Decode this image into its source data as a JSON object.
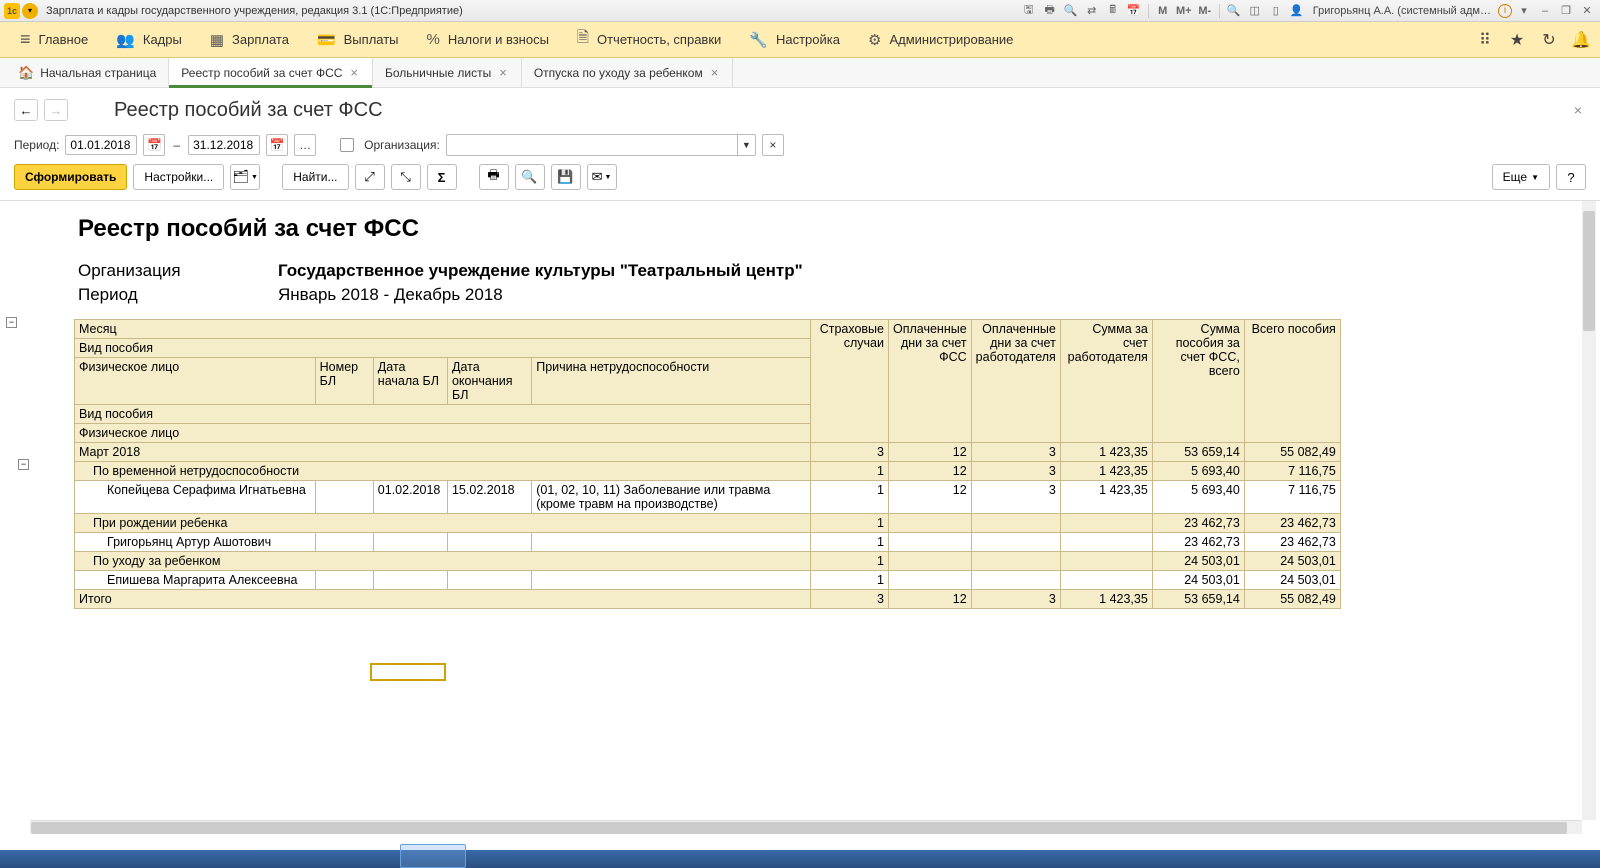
{
  "titlebar": {
    "app_title": "Зарплата и кадры государственного учреждения, редакция 3.1  (1С:Предприятие)",
    "user": "Григорьянц А.А. (системный адм…"
  },
  "mainmenu": {
    "items": [
      {
        "icon": "≡",
        "label": "Главное"
      },
      {
        "icon": "👥",
        "label": "Кадры"
      },
      {
        "icon": "▦",
        "label": "Зарплата"
      },
      {
        "icon": "💳",
        "label": "Выплаты"
      },
      {
        "icon": "%",
        "label": "Налоги и взносы"
      },
      {
        "icon": "🗎",
        "label": "Отчетность, справки"
      },
      {
        "icon": "🔧",
        "label": "Настройка"
      },
      {
        "icon": "⚙",
        "label": "Администрирование"
      }
    ]
  },
  "tabs": {
    "home": "Начальная страница",
    "items": [
      {
        "label": "Реестр пособий за счет ФСС",
        "active": true
      },
      {
        "label": "Больничные листы",
        "active": false
      },
      {
        "label": "Отпуска по уходу за ребенком",
        "active": false
      }
    ]
  },
  "page": {
    "title": "Реестр пособий за счет ФСС"
  },
  "filter": {
    "period_label": "Период:",
    "date_from": "01.01.2018",
    "date_to": "31.12.2018",
    "org_label": "Организация:"
  },
  "toolbar": {
    "generate": "Сформировать",
    "settings": "Настройки...",
    "find": "Найти...",
    "more": "Еще"
  },
  "report": {
    "title": "Реестр пособий за счет ФСС",
    "org_label": "Организация",
    "org_value": "Государственное учреждение культуры \"Театральный центр\"",
    "period_label": "Период",
    "period_value": "Январь 2018 - Декабрь 2018",
    "headers": {
      "month": "Месяц",
      "benefit_type": "Вид пособия",
      "person": "Физическое лицо",
      "bl_num": "Номер БЛ",
      "bl_start": "Дата начала БЛ",
      "bl_end": "Дата окончания БЛ",
      "reason": "Причина нетрудоспособности",
      "benefit_type2": "Вид пособия",
      "person2": "Физическое лицо",
      "ins_cases": "Страховые случаи",
      "paid_fss": "Оплаченные дни за счет ФСС",
      "paid_emp": "Оплаченные дни за счет работодателя",
      "sum_emp": "Сумма за счет работодателя",
      "sum_fss": "Сумма пособия за счет ФСС, всего",
      "sum_total": "Всего пособия"
    },
    "rows": [
      {
        "lvl": 0,
        "shade": true,
        "c0": "Март 2018",
        "ins": "3",
        "dfss": "12",
        "demp": "3",
        "semp": "1 423,35",
        "sfss": "53 659,14",
        "stot": "55 082,49"
      },
      {
        "lvl": 1,
        "shade": true,
        "c0": "По временной нетрудоспособности",
        "ins": "1",
        "dfss": "12",
        "demp": "3",
        "semp": "1 423,35",
        "sfss": "5 693,40",
        "stot": "7 116,75"
      },
      {
        "lvl": 2,
        "shade": false,
        "c0": "Копейцева Серафима Игнатьевна",
        "bl_num": "",
        "bl_start": "01.02.2018",
        "bl_end": "15.02.2018",
        "reason": "(01, 02, 10, 11) Заболевание или травма (кроме травм на производстве)",
        "ins": "1",
        "dfss": "12",
        "demp": "3",
        "semp": "1 423,35",
        "sfss": "5 693,40",
        "stot": "7 116,75"
      },
      {
        "lvl": 1,
        "shade": true,
        "c0": "При рождении ребенка",
        "ins": "1",
        "dfss": "",
        "demp": "",
        "semp": "",
        "sfss": "23 462,73",
        "stot": "23 462,73"
      },
      {
        "lvl": 2,
        "shade": false,
        "c0": "Григорьянц Артур Ашотович",
        "ins": "1",
        "dfss": "",
        "demp": "",
        "semp": "",
        "sfss": "23 462,73",
        "stot": "23 462,73"
      },
      {
        "lvl": 1,
        "shade": true,
        "c0": "По уходу за ребенком",
        "ins": "1",
        "dfss": "",
        "demp": "",
        "semp": "",
        "sfss": "24 503,01",
        "stot": "24 503,01"
      },
      {
        "lvl": 2,
        "shade": false,
        "c0": "Епишева Маргарита Алексеевна",
        "ins": "1",
        "dfss": "",
        "demp": "",
        "semp": "",
        "sfss": "24 503,01",
        "stot": "24 503,01"
      }
    ],
    "total": {
      "label": "Итого",
      "ins": "3",
      "dfss": "12",
      "demp": "3",
      "semp": "1 423,35",
      "sfss": "53 659,14",
      "stot": "55 082,49"
    }
  }
}
